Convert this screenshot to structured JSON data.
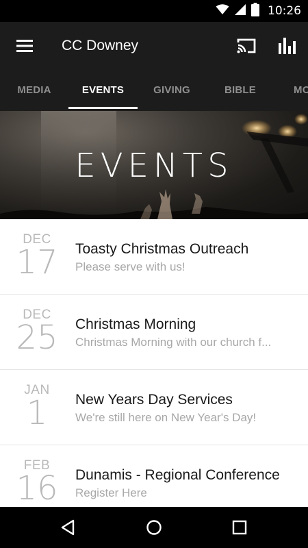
{
  "status_bar": {
    "time": "10:26",
    "icons": [
      "wifi-icon",
      "cell-signal-icon",
      "battery-icon"
    ]
  },
  "app_bar": {
    "title": "CC Downey",
    "icons": [
      "menu-icon",
      "cast-icon",
      "bar-chart-icon"
    ]
  },
  "tabs": [
    {
      "label": "MEDIA",
      "active": false
    },
    {
      "label": "EVENTS",
      "active": true
    },
    {
      "label": "GIVING",
      "active": false
    },
    {
      "label": "BIBLE",
      "active": false
    },
    {
      "label": "MO",
      "active": false
    }
  ],
  "hero": {
    "title": "EVENTS"
  },
  "events": [
    {
      "month": "DEC",
      "day": "17",
      "title": "Toasty Christmas Outreach",
      "subtitle": "Please serve with us!"
    },
    {
      "month": "DEC",
      "day": "25",
      "title": "Christmas Morning",
      "subtitle": "Christmas Morning with our church f..."
    },
    {
      "month": "JAN",
      "day": "1",
      "title": "New Years Day Services",
      "subtitle": "We're still here on New Year's Day!"
    },
    {
      "month": "FEB",
      "day": "16",
      "title": "Dunamis - Regional Conference",
      "subtitle": "Register Here"
    }
  ],
  "nav_bar": {
    "icons": [
      "back-icon",
      "home-icon",
      "recents-icon"
    ]
  },
  "colors": {
    "app_bar": "#1c1c1c",
    "tab_inactive": "#8e8e8e",
    "tab_active": "#ffffff",
    "date_gray": "#b9b9b9",
    "subtitle_gray": "#a8a8a8"
  }
}
